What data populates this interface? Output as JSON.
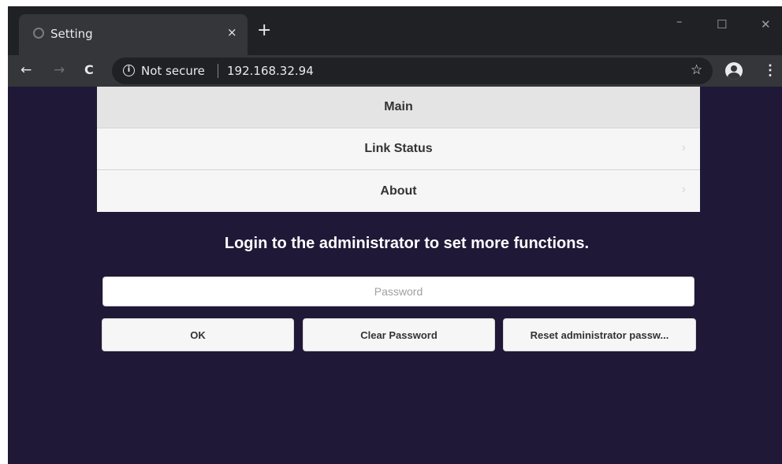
{
  "browser": {
    "tab_title": "Setting",
    "tab_close": "×",
    "new_tab": "+",
    "window_controls": {
      "minimize": "–",
      "maximize": "☐",
      "close": "✕"
    },
    "nav": {
      "back": "←",
      "forward": "→",
      "reload": "C"
    },
    "security_label": "Not secure",
    "url": "192.168.32.94",
    "icons": [
      "globe-icon",
      "close-icon",
      "plus-icon",
      "back-arrow-icon",
      "forward-arrow-icon",
      "reload-icon",
      "info-icon",
      "star-icon",
      "profile-icon",
      "kebab-menu-icon"
    ]
  },
  "menu": {
    "items": [
      {
        "label": "Main",
        "active": true
      },
      {
        "label": "Link Status",
        "active": false
      },
      {
        "label": "About",
        "active": false
      }
    ]
  },
  "login": {
    "headline": "Login to the administrator to set more functions.",
    "password_placeholder": "Password",
    "password_value": "",
    "ok_label": "OK",
    "clear_label": "Clear Password",
    "reset_label": "Reset administrator passw..."
  },
  "colors": {
    "page_background": "#1f1837",
    "chrome_dark": "#202124",
    "chrome_tab": "#35363a",
    "menu_active": "#e4e4e4",
    "menu_item": "#f6f6f6",
    "headline_text": "#ffffff"
  }
}
